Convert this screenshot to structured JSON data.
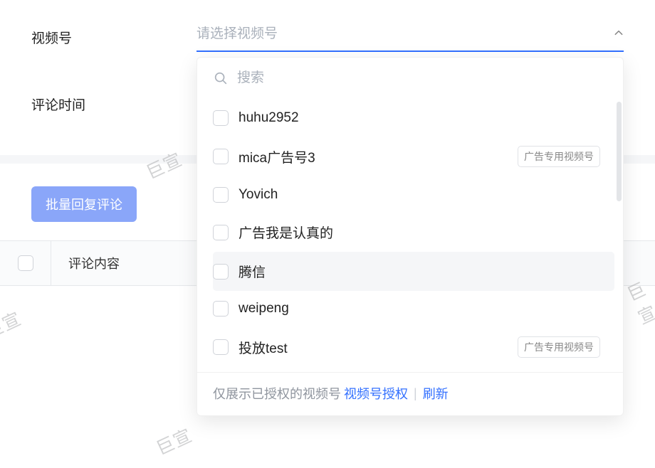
{
  "form": {
    "label_video": "视频号",
    "label_time": "评论时间",
    "select_placeholder": "请选择视频号"
  },
  "bulk_button": "批量回复评论",
  "table": {
    "col_comment": "评论内容"
  },
  "dropdown": {
    "search_placeholder": "搜索",
    "badge_text": "广告专用视频号",
    "options": [
      {
        "label": "huhu2952",
        "badged": false,
        "hovered": false
      },
      {
        "label": "mica广告号3",
        "badged": true,
        "hovered": false
      },
      {
        "label": "Yovich",
        "badged": false,
        "hovered": false
      },
      {
        "label": "广告我是认真的",
        "badged": false,
        "hovered": false
      },
      {
        "label": "腾信",
        "badged": false,
        "hovered": true
      },
      {
        "label": "weipeng",
        "badged": false,
        "hovered": false
      },
      {
        "label": "投放test",
        "badged": true,
        "hovered": false
      }
    ],
    "footer_note": "仅展示已授权的视频号",
    "footer_link_auth": "视频号授权",
    "footer_link_refresh": "刷新"
  },
  "watermark_text": "巨宣"
}
